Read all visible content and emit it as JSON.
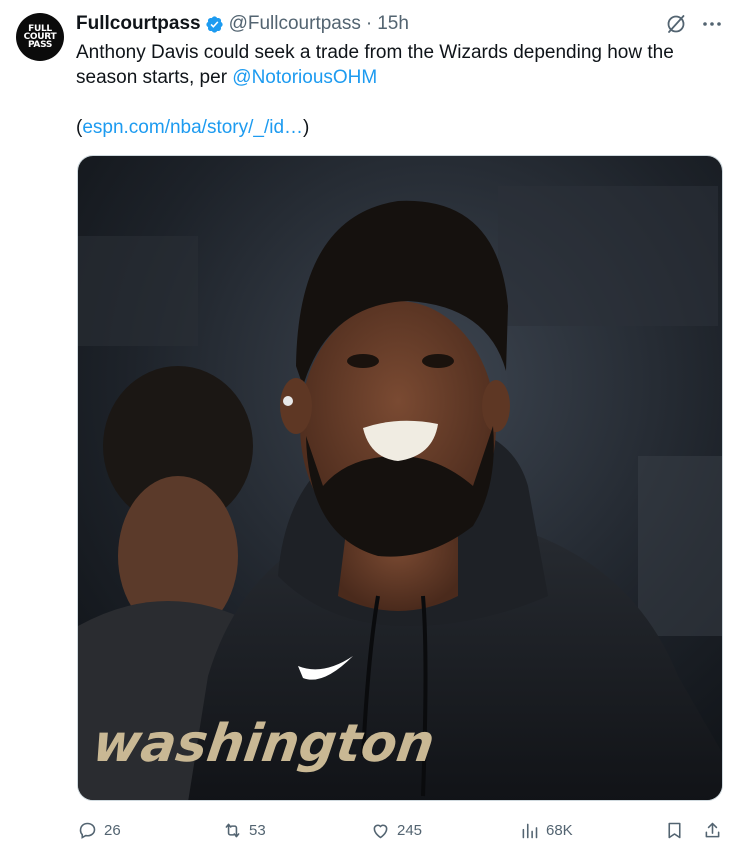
{
  "author": {
    "display_name": "Fullcourtpass",
    "handle": "@Fullcourtpass",
    "separator": "·",
    "time": "15h",
    "avatar_lines": [
      "FULL",
      "COURT",
      "PASS"
    ],
    "verified_color": "#1d9bf0"
  },
  "tweet": {
    "text_main": "Anthony Davis could seek a trade from the Wizards depending how the season starts, per ",
    "mention": "@NotoriousOHM",
    "link_open": "(",
    "link": "espn.com/nba/story/_/id…",
    "link_close": ")"
  },
  "media": {
    "jersey_text": "washington"
  },
  "actions": {
    "reply_count": "26",
    "retweet_count": "53",
    "like_count": "245",
    "views_count": "68K"
  },
  "icons": [
    "grok-icon",
    "more-icon",
    "reply-icon",
    "retweet-icon",
    "like-icon",
    "views-icon",
    "bookmark-icon",
    "share-icon"
  ],
  "colors": {
    "link": "#1d9bf0",
    "muted": "#536471",
    "text": "#0f1419"
  }
}
